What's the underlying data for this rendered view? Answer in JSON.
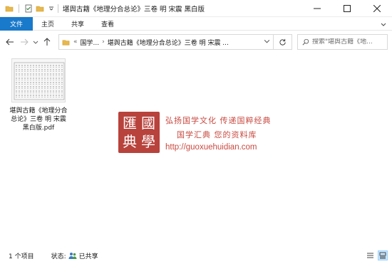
{
  "window": {
    "title": "堪舆古籍《地理分合总论》三卷 明 宋震 黑白版"
  },
  "ribbon": {
    "tabs": [
      "文件",
      "主页",
      "共享",
      "查看"
    ]
  },
  "address": {
    "overflow": "«",
    "crumbs": [
      "国学...",
      "堪舆古籍《地理分合总论》三卷 明 宋震 ..."
    ]
  },
  "search": {
    "placeholder": "搜索\"堪舆古籍《地..."
  },
  "files": [
    {
      "name": "堪舆古籍《地理分合总论》三卷 明 宋震 黑白版.pdf"
    }
  ],
  "watermark": {
    "seal_chars": [
      "匯",
      "國",
      "典",
      "學"
    ],
    "line1": "弘扬国学文化  传递国粹经典",
    "line2": "国学汇典 您的资料库",
    "url": "http://guoxuehuidian.com"
  },
  "statusbar": {
    "count": "1 个项目",
    "state_label": "状态:",
    "state_value": "已共享"
  },
  "colors": {
    "file_tab": "#1979ca",
    "seal": "#b8423c",
    "watermark_text": "#c84a41"
  }
}
